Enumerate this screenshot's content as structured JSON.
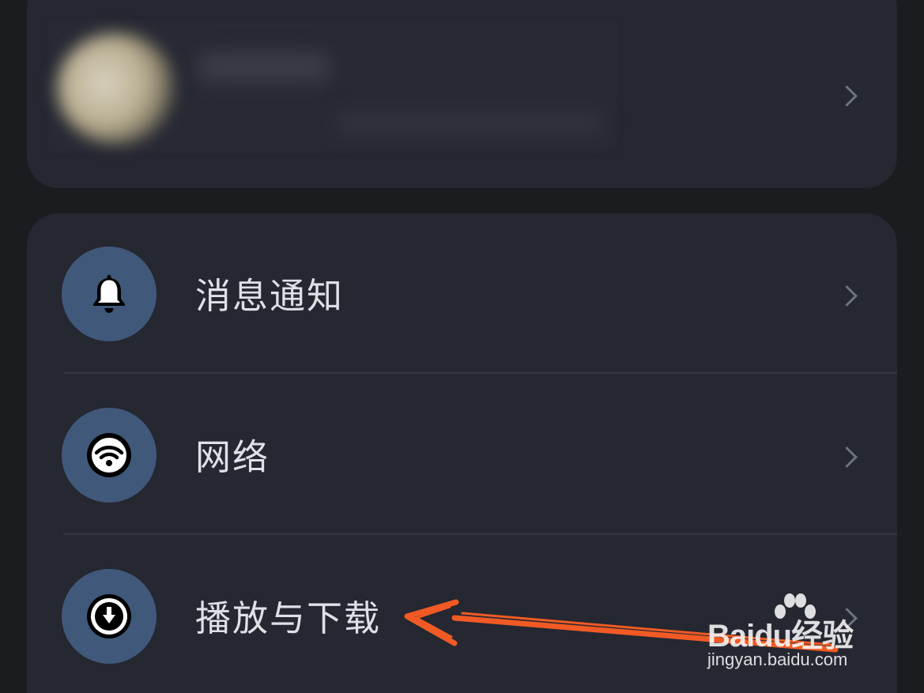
{
  "colors": {
    "background": "#1b1c20",
    "card": "#252731",
    "icon_circle": "#40587a",
    "text": "#dfe1e8",
    "chevron": "#6f7280",
    "annotation_arrow": "#f15a24"
  },
  "profile": {
    "avatar_icon": "avatar-blurred",
    "chevron_icon": "chevron-right-icon"
  },
  "settings": {
    "items": [
      {
        "label": "消息通知",
        "icon": "bell-icon"
      },
      {
        "label": "网络",
        "icon": "wifi-icon"
      },
      {
        "label": "播放与下载",
        "icon": "download-icon"
      }
    ]
  },
  "watermark": {
    "logo": "Baidu经验",
    "url": "jingyan.baidu.com"
  }
}
